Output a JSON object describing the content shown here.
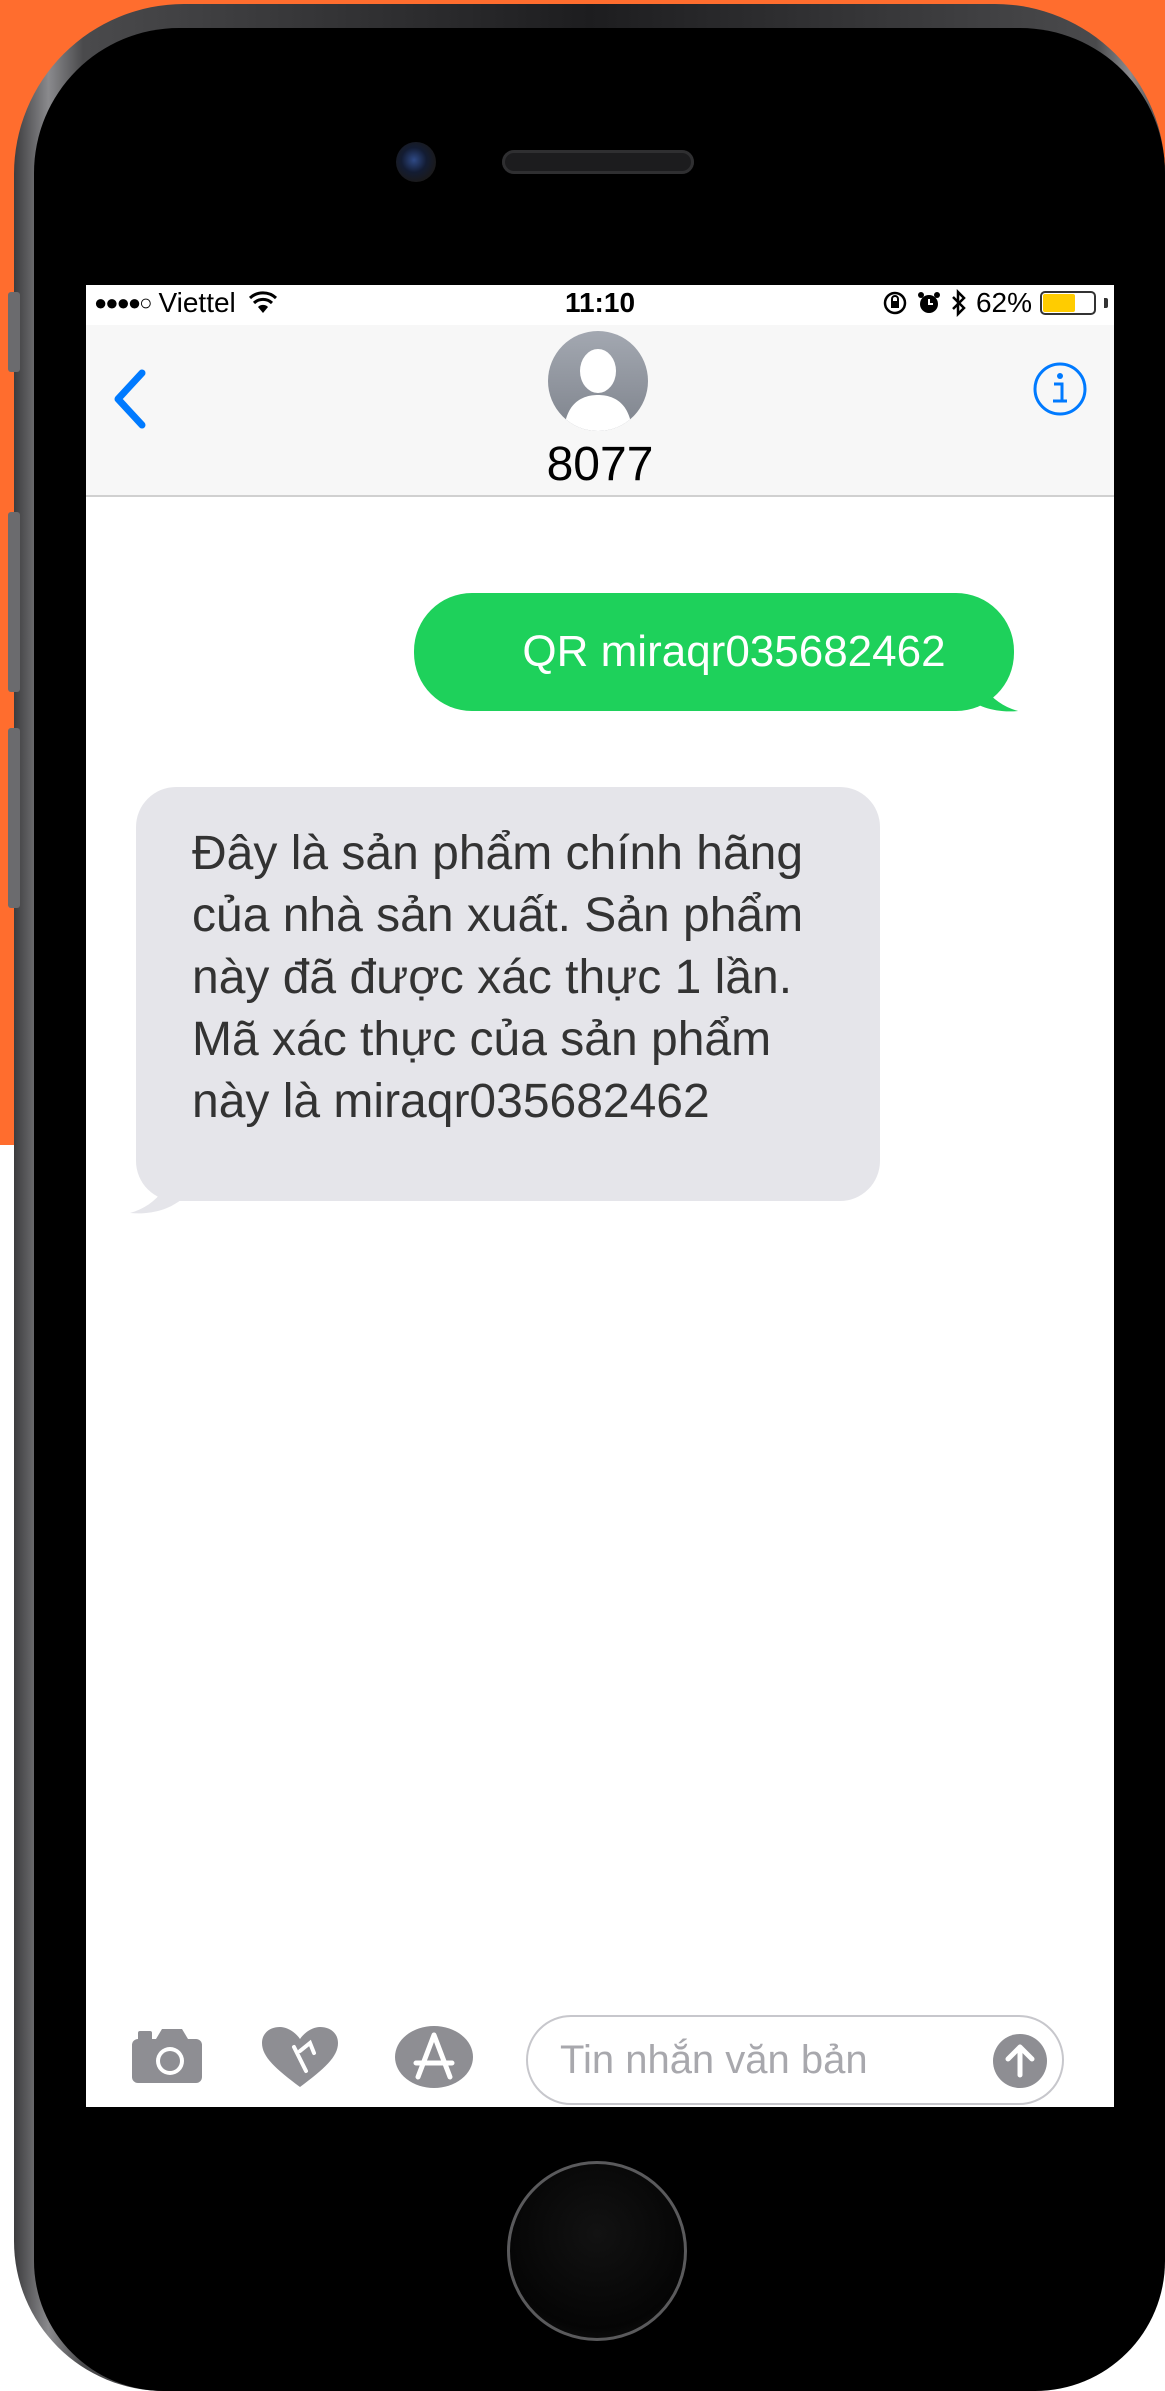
{
  "status_bar": {
    "signal": "●●●●○",
    "carrier": "Viettel",
    "time": "11:10",
    "battery_percent": "62%",
    "battery_level": 0.62
  },
  "header": {
    "contact_name": "8077"
  },
  "messages": [
    {
      "direction": "sent",
      "text": "QR miraqr035682462"
    },
    {
      "direction": "received",
      "lines": [
        "Đây là sản phẩm chính hãng",
        "của nhà sản xuất. Sản phẩm",
        "này đã được xác thực 1 lần.",
        "Mã xác thực của sản phẩm",
        "này là miraqr035682462"
      ]
    }
  ],
  "input_bar": {
    "placeholder": "Tin nhắn văn bản"
  },
  "colors": {
    "background_accent": "#ff6d2e",
    "sent_bubble": "#1ed15b",
    "received_bubble": "#e5e5ea",
    "ios_blue": "#007aff",
    "battery_fill": "#ffcc00"
  },
  "icons": [
    "back-chevron-icon",
    "info-icon",
    "wifi-icon",
    "rotation-lock-icon",
    "alarm-icon",
    "bluetooth-icon",
    "camera-icon",
    "digital-touch-heart-icon",
    "app-store-icon",
    "send-arrow-icon"
  ]
}
